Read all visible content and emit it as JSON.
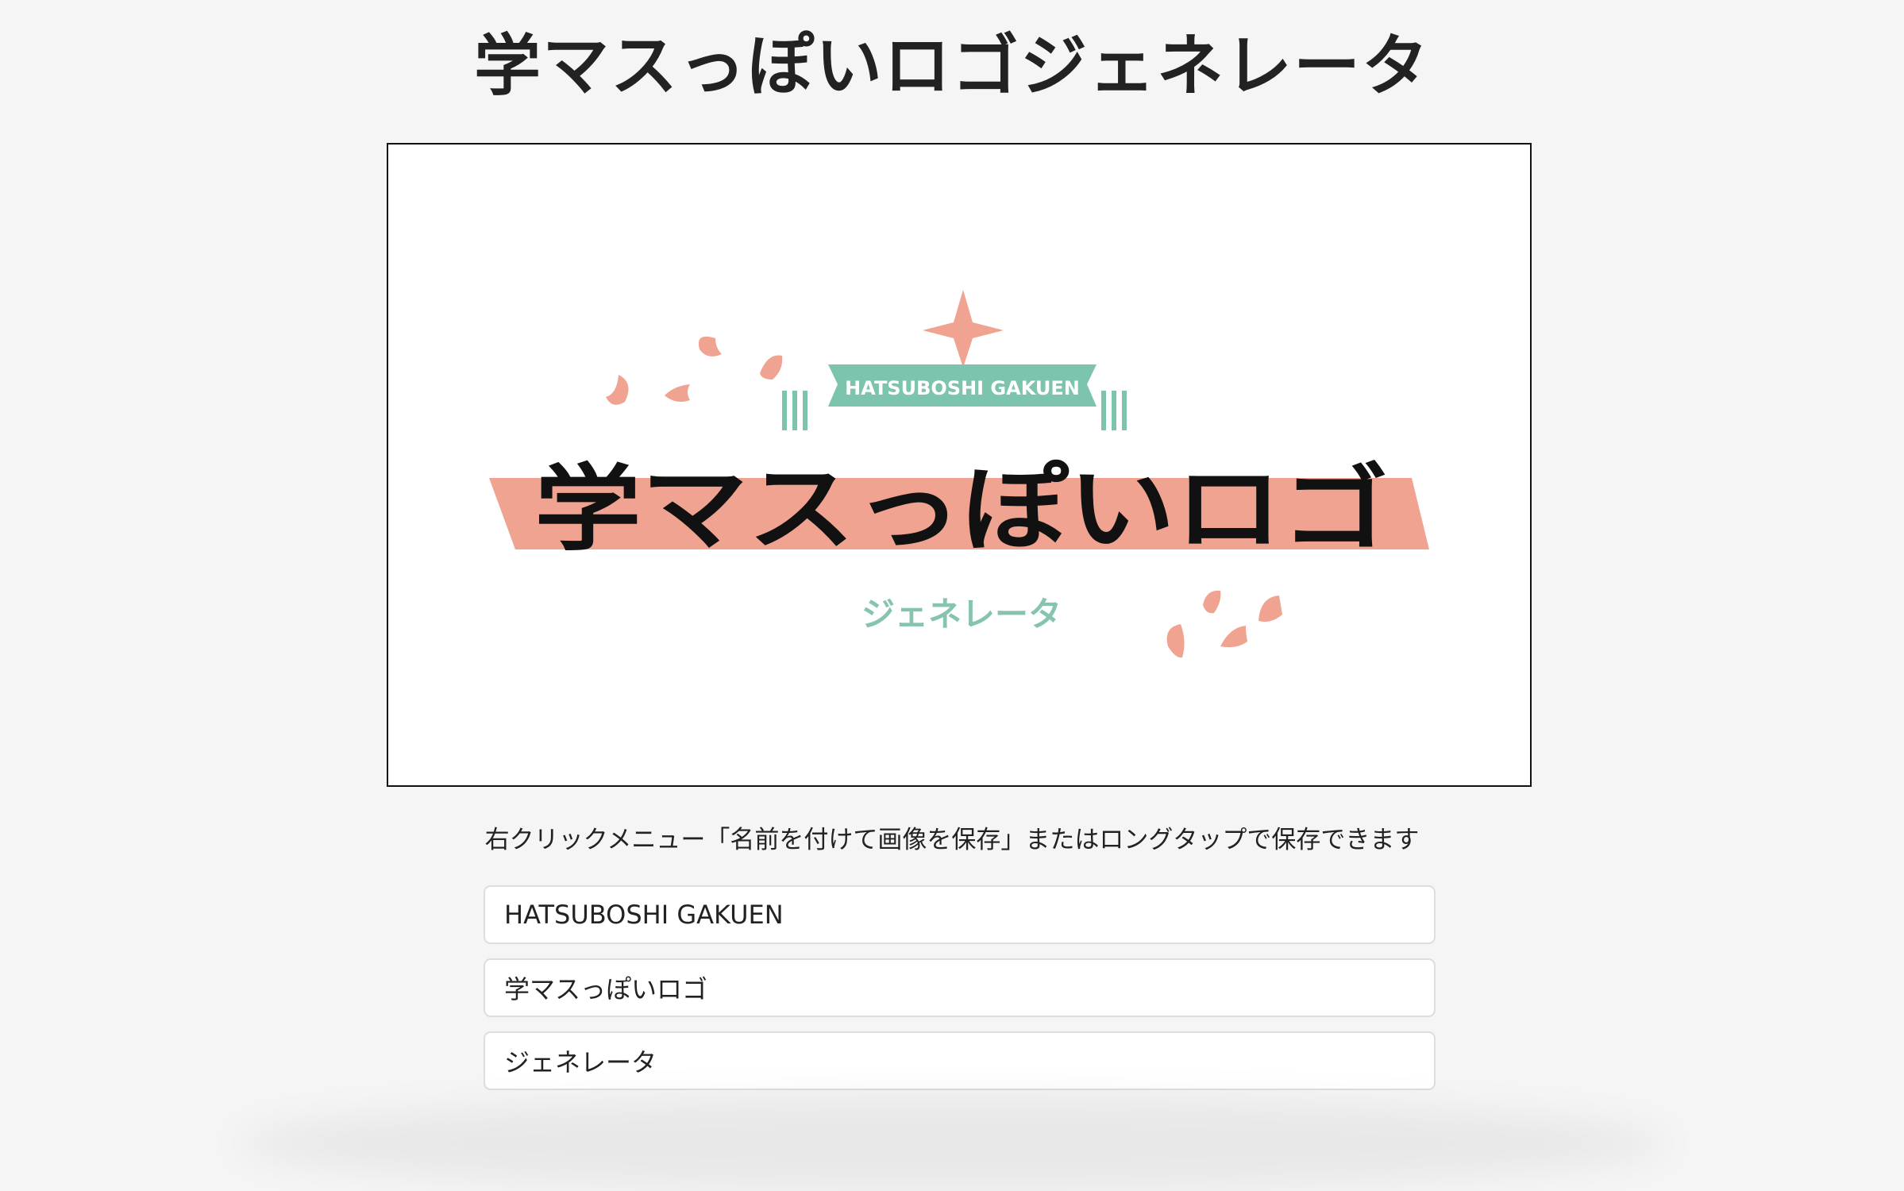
{
  "page": {
    "title": "学マスっぽいロゴジェネレータ",
    "save_hint": "右クリックメニュー「名前を付けて画像を保存」またはロングタップで保存できます"
  },
  "logo": {
    "banner_text": "HATSUBOSHI GAKUEN",
    "main_text": "学マスっぽいロゴ",
    "sub_text": "ジェネレータ",
    "colors": {
      "salmon": "#f0a390",
      "teal": "#7cc4ae",
      "sub_text": "#86c4b0",
      "main_text": "#111111"
    }
  },
  "form": {
    "banner_input_value": "HATSUBOSHI GAKUEN",
    "main_input_value": "学マスっぽいロゴ",
    "sub_input_value": "ジェネレータ"
  }
}
